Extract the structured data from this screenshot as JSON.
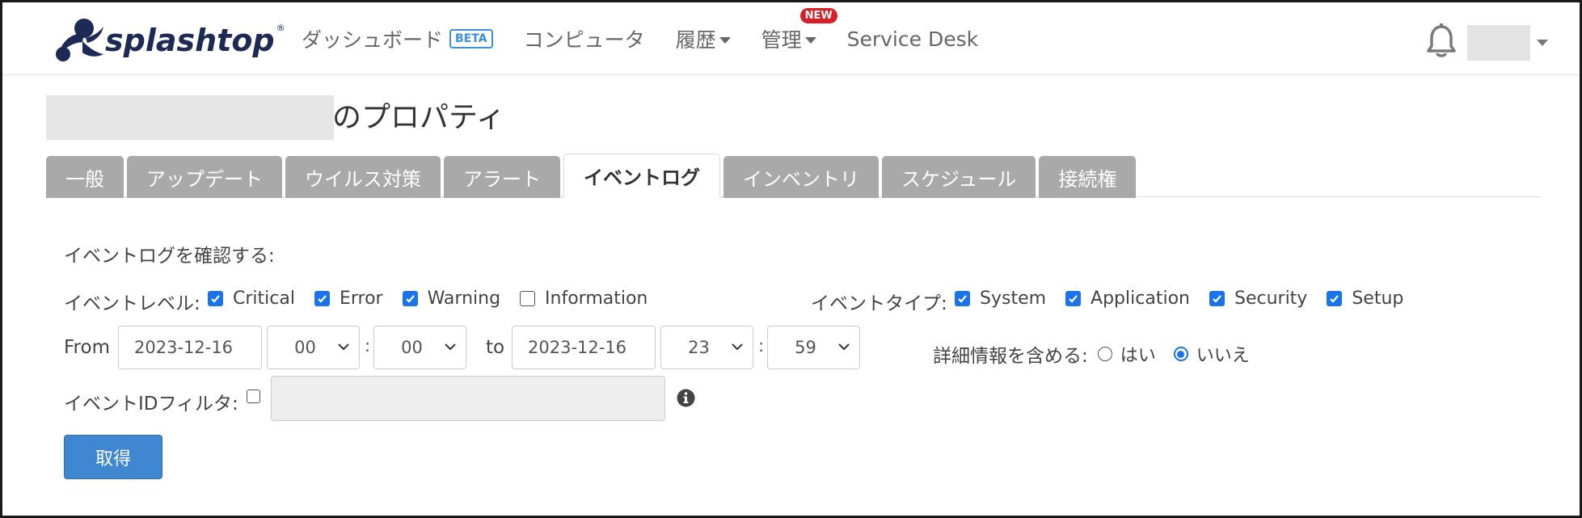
{
  "brand": {
    "name": "splashtop",
    "reg": "®"
  },
  "nav": {
    "dashboard": "ダッシュボード",
    "beta": "BETA",
    "computers": "コンピュータ",
    "history": "履歴",
    "manage": "管理",
    "new_badge": "NEW",
    "service_desk": "Service Desk"
  },
  "page": {
    "title_suffix": "のプロパティ"
  },
  "tabs": [
    {
      "label": "一般",
      "active": false
    },
    {
      "label": "アップデート",
      "active": false
    },
    {
      "label": "ウイルス対策",
      "active": false
    },
    {
      "label": "アラート",
      "active": false
    },
    {
      "label": "イベントログ",
      "active": true
    },
    {
      "label": "インベントリ",
      "active": false
    },
    {
      "label": "スケジュール",
      "active": false
    },
    {
      "label": "接続権",
      "active": false
    }
  ],
  "form": {
    "heading": "イベントログを確認する:",
    "level_label": "イベントレベル:",
    "levels": [
      {
        "label": "Critical",
        "checked": true
      },
      {
        "label": "Error",
        "checked": true
      },
      {
        "label": "Warning",
        "checked": true
      },
      {
        "label": "Information",
        "checked": false
      }
    ],
    "type_label": "イベントタイプ:",
    "types": [
      {
        "label": "System",
        "checked": true
      },
      {
        "label": "Application",
        "checked": true
      },
      {
        "label": "Security",
        "checked": true
      },
      {
        "label": "Setup",
        "checked": true
      }
    ],
    "from_label": "From",
    "from_date": "2023-12-16",
    "from_hour": "00",
    "from_minute": "00",
    "to_label": "to",
    "to_date": "2023-12-16",
    "to_hour": "23",
    "to_minute": "59",
    "time_sep": ":",
    "detail_label": "詳細情報を含める:",
    "detail_yes": "はい",
    "detail_no": "いいえ",
    "detail_selected": "no",
    "id_filter_label": "イベントIDフィルタ:",
    "id_filter_checked": false,
    "id_filter_value": "",
    "submit": "取得"
  },
  "colors": {
    "accent": "#3f87d0",
    "checkbox": "#1a73e8",
    "tab_inactive": "#a9a9a9",
    "new_badge": "#d91f26",
    "logo": "#1c2a55"
  }
}
